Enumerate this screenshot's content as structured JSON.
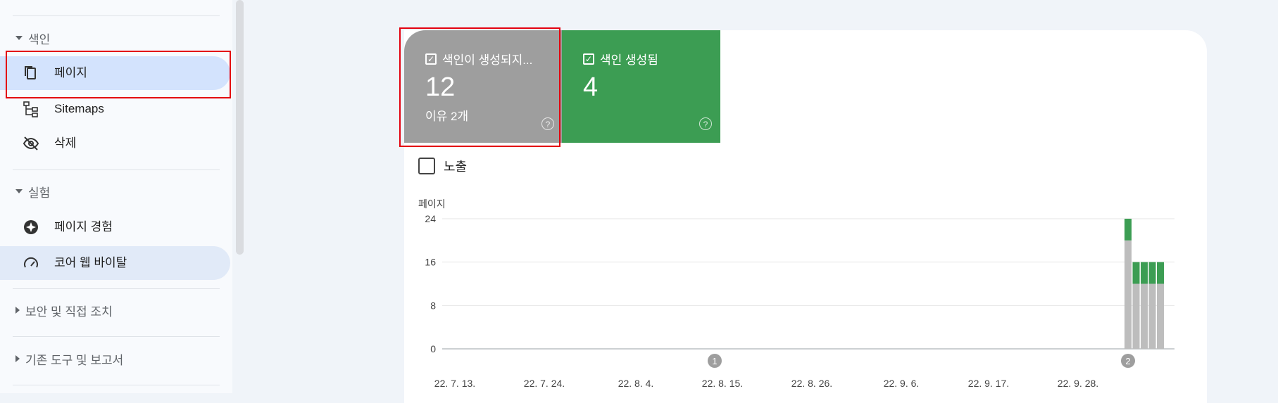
{
  "sidebar": {
    "index_section": "색인",
    "items": [
      {
        "label": "페이지",
        "icon": "pages-icon"
      },
      {
        "label": "Sitemaps",
        "icon": "sitemap-icon"
      },
      {
        "label": "삭제",
        "icon": "removals-icon"
      }
    ],
    "experience_section": "실험",
    "exp_items": [
      {
        "label": "페이지 경험",
        "icon": "page-experience-icon"
      },
      {
        "label": "코어 웹 바이탈",
        "icon": "gauge-icon"
      }
    ],
    "security_section": "보안 및 직접 조치",
    "legacy_section": "기존 도구 및 보고서"
  },
  "cards": {
    "not_indexed": {
      "title": "색인이 생성되지...",
      "count": "12",
      "sub": "이유 2개"
    },
    "indexed": {
      "title": "색인 생성됨",
      "count": "4"
    }
  },
  "impressions_label": "노출",
  "chart_data": {
    "type": "bar",
    "ylabel": "페이지",
    "ylim": [
      0,
      24
    ],
    "yticks": [
      0,
      8,
      16,
      24
    ],
    "xticks": [
      "22. 7. 13.",
      "22. 7. 24.",
      "22. 8. 4.",
      "22. 8. 15.",
      "22. 8. 26.",
      "22. 9. 6.",
      "22. 9. 17.",
      "22. 9. 28."
    ],
    "annotations": [
      {
        "label": "1"
      },
      {
        "label": "2"
      }
    ],
    "series": [
      {
        "color": "#bdbdbd",
        "values": [
          20,
          12,
          12,
          12,
          12
        ]
      },
      {
        "color": "#3c9d53",
        "values": [
          4,
          4,
          4,
          4,
          4
        ]
      }
    ]
  },
  "colors": {
    "not_indexed": "#9e9e9e",
    "indexed": "#3c9d53",
    "highlight": "#e3000f",
    "active_bg": "#d3e3fd"
  }
}
